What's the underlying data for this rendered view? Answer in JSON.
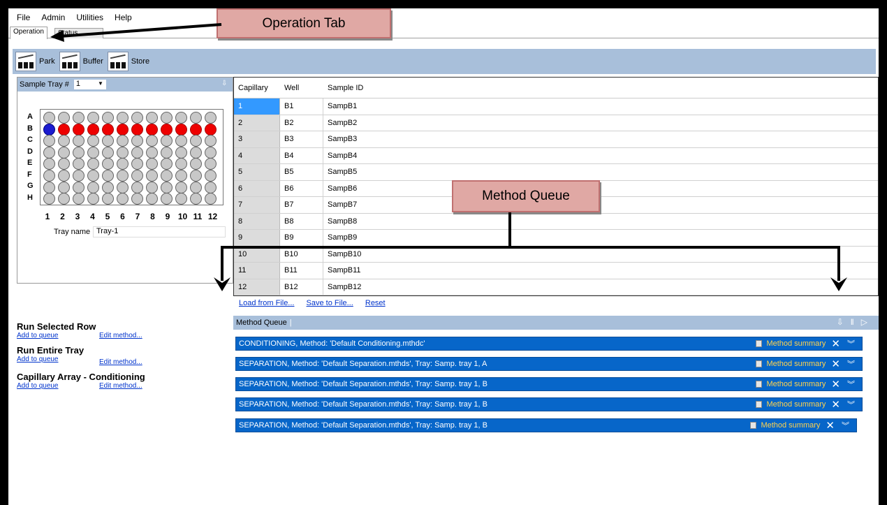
{
  "menu": [
    "File",
    "Admin",
    "Utilities",
    "Help"
  ],
  "tabs": {
    "operation": "Operation",
    "status": "Status"
  },
  "toolbar": {
    "park": "Park",
    "buffer": "Buffer",
    "store": "Store"
  },
  "tray": {
    "header_label": "Sample Tray #",
    "selected": "1",
    "rows": [
      "A",
      "B",
      "C",
      "D",
      "E",
      "F",
      "G",
      "H"
    ],
    "cols": [
      "1",
      "2",
      "3",
      "4",
      "5",
      "6",
      "7",
      "8",
      "9",
      "10",
      "11",
      "12"
    ],
    "tray_name_label": "Tray name",
    "tray_name": "Tray-1"
  },
  "table": {
    "headers": [
      "Capillary",
      "Well",
      "Sample ID"
    ],
    "rows": [
      [
        "1",
        "B1",
        "SampB1"
      ],
      [
        "2",
        "B2",
        "SampB2"
      ],
      [
        "3",
        "B3",
        "SampB3"
      ],
      [
        "4",
        "B4",
        "SampB4"
      ],
      [
        "5",
        "B5",
        "SampB5"
      ],
      [
        "6",
        "B6",
        "SampB6"
      ],
      [
        "7",
        "B7",
        "SampB7"
      ],
      [
        "8",
        "B8",
        "SampB8"
      ],
      [
        "9",
        "B9",
        "SampB9"
      ],
      [
        "10",
        "B10",
        "SampB10"
      ],
      [
        "11",
        "B11",
        "SampB11"
      ],
      [
        "12",
        "B12",
        "SampB12"
      ]
    ],
    "links": {
      "load": "Load from File...",
      "save": "Save to File...",
      "reset": "Reset"
    }
  },
  "run": {
    "selected_row": "Run Selected Row",
    "entire_tray": "Run Entire Tray",
    "conditioning": "Capillary Array - Conditioning",
    "add_to_queue": "Add to queue",
    "edit_method": "Edit method..."
  },
  "queue": {
    "title": "Method Queue",
    "summary_label": "Method summary",
    "items": [
      "CONDITIONING, Method: 'Default Conditioning.mthdc'",
      "SEPARATION, Method: 'Default Separation.mthds', Tray: Samp. tray 1, A",
      "SEPARATION, Method: 'Default Separation.mthds', Tray: Samp. tray 1, B",
      "SEPARATION, Method: 'Default Separation.mthds', Tray: Samp. tray 1, B",
      "SEPARATION, Method: 'Default Separation.mthds', Tray: Samp. tray 1, B"
    ]
  },
  "callouts": {
    "operation_tab": "Operation Tab",
    "method_queue": "Method Queue"
  }
}
